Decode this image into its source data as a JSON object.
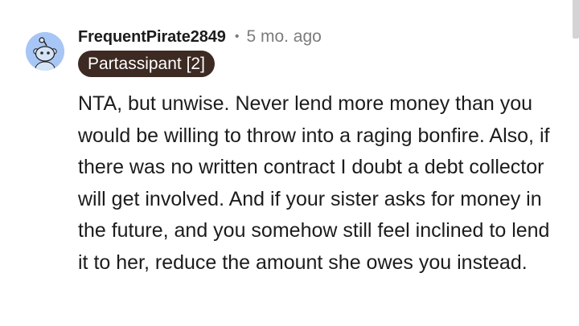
{
  "comment": {
    "username": "FrequentPirate2849",
    "separator": "•",
    "timestamp": "5 mo. ago",
    "flair": "Partassipant [2]",
    "body": "NTA, but unwise. Never lend more money than you would be willing to throw into a raging bonfire. Also, if there was no written contract I doubt a debt collector will get involved. And if your sister asks for money in the future, and you somehow still feel inclined to lend it to her, reduce the amount she owes you instead.",
    "avatar_icon": "snoo-avatar-icon"
  },
  "colors": {
    "avatar_bg": "#a8c6f5",
    "flair_bg": "#3d2a22",
    "text": "#1c1c1c",
    "meta": "#7c7c7c"
  }
}
